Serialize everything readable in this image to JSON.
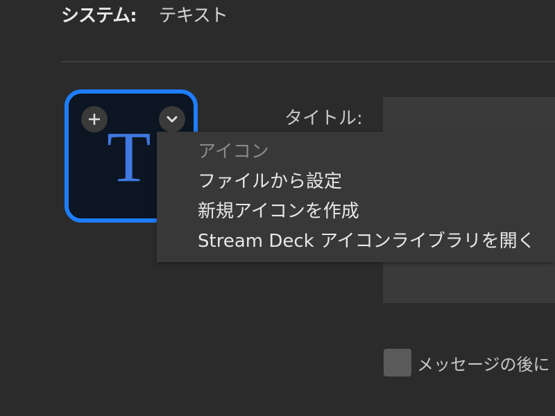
{
  "header": {
    "label": "システム:",
    "value": "テキスト"
  },
  "key_tile": {
    "letter": "T",
    "add_icon": "plus-icon",
    "dropdown_icon": "chevron-down-icon",
    "border_color": "#1f7dff",
    "letter_color": "#3f78e0",
    "background_color": "#0c1522"
  },
  "title_label": "タイトル:",
  "context_menu": {
    "items": [
      {
        "label": "アイコン",
        "disabled": true
      },
      {
        "label": "ファイルから設定",
        "disabled": false
      },
      {
        "label": "新規アイコンを作成",
        "disabled": false
      },
      {
        "label": "Stream Deck アイコンライブラリを開く",
        "disabled": false
      }
    ]
  },
  "checkbox": {
    "label": "メッセージの後に"
  }
}
